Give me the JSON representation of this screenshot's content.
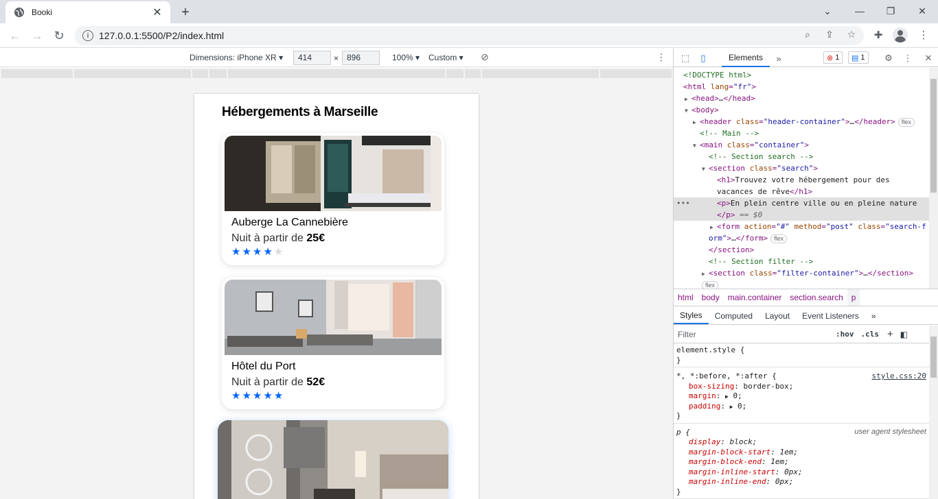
{
  "browser": {
    "tab_title": "Booki",
    "url": "127.0.0.1:5500/P2/index.html"
  },
  "device_toolbar": {
    "dimensions_label": "Dimensions: iPhone XR",
    "width": "414",
    "times": "×",
    "height": "896",
    "zoom": "100%",
    "throttle": "Custom"
  },
  "page": {
    "section_title": "Hébergements à Marseille",
    "cards": [
      {
        "name": "Auberge La Cannebière",
        "price_prefix": "Nuit à partir de ",
        "price": "25€",
        "rating": 4
      },
      {
        "name": "Hôtel du Port",
        "price_prefix": "Nuit à partir de ",
        "price": "52€",
        "rating": 5
      }
    ]
  },
  "devtools": {
    "tab_elements": "Elements",
    "error_count": "1",
    "message_count": "1",
    "breadcrumbs": [
      "html",
      "body",
      "main.container",
      "section.search",
      "p"
    ],
    "sub_tabs": [
      "Styles",
      "Computed",
      "Layout",
      "Event Listeners"
    ],
    "filter_placeholder": "Filter",
    "hov": ":hov",
    "cls": ".cls",
    "dom": {
      "doctype": "<!DOCTYPE html>",
      "h1_text_1": "Trouvez votre hébergement pour des",
      "h1_text_2": "vacances de rêve",
      "p_text": "En plein centre ville ou en pleine nature",
      "comment_main": "<!-- Main -->",
      "comment_search": "<!-- Section search -->",
      "comment_filter": "<!-- Section filter -->",
      "eq_dollar": "== $0"
    },
    "styles": {
      "element_style": "element.style {",
      "universal_selector": "*, *:before, *:after {",
      "universal_src": "style.css:20",
      "p_selector": "p {",
      "ua_label": "user agent stylesheet"
    }
  }
}
